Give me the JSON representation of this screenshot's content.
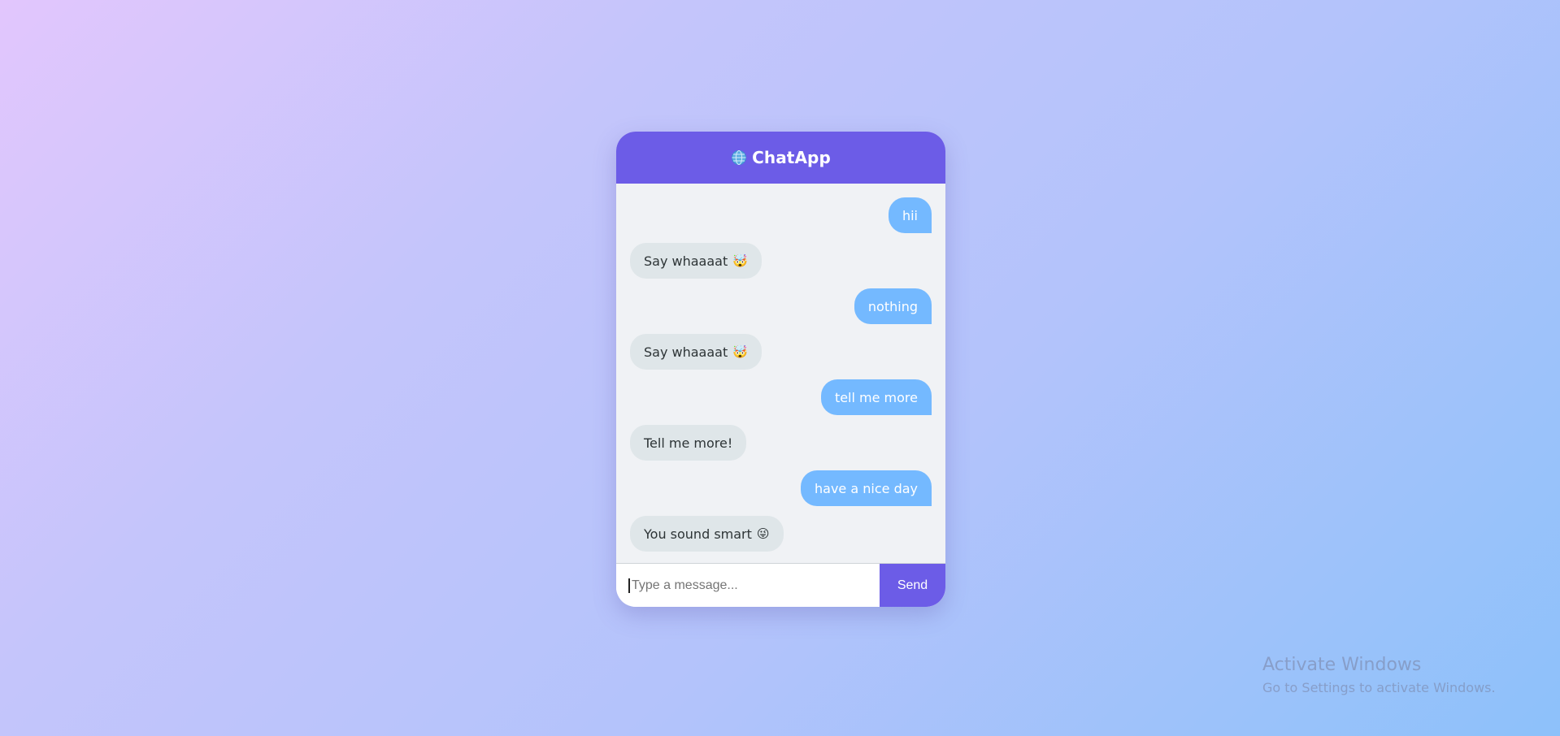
{
  "header": {
    "title": "ChatApp",
    "icon": "globe-icon"
  },
  "messages": [
    {
      "sender": "user",
      "text": "hii",
      "emoji": ""
    },
    {
      "sender": "bot",
      "text": "Say whaaaat",
      "emoji": "🤯"
    },
    {
      "sender": "user",
      "text": "nothing",
      "emoji": ""
    },
    {
      "sender": "bot",
      "text": "Say whaaaat",
      "emoji": "🤯"
    },
    {
      "sender": "user",
      "text": "tell me more",
      "emoji": ""
    },
    {
      "sender": "bot",
      "text": "Tell me more!",
      "emoji": ""
    },
    {
      "sender": "user",
      "text": "have a nice day",
      "emoji": ""
    },
    {
      "sender": "bot",
      "text": "You sound smart",
      "emoji": "😜"
    }
  ],
  "input": {
    "value": "",
    "placeholder": "Type a message..."
  },
  "send_label": "Send",
  "colors": {
    "accent": "#6c5ce7",
    "user_bubble": "#74b9ff",
    "bot_bubble": "#dfe6e9",
    "chat_background": "#f0f2f5"
  },
  "watermark": {
    "title": "Activate Windows",
    "subtitle": "Go to Settings to activate Windows."
  }
}
